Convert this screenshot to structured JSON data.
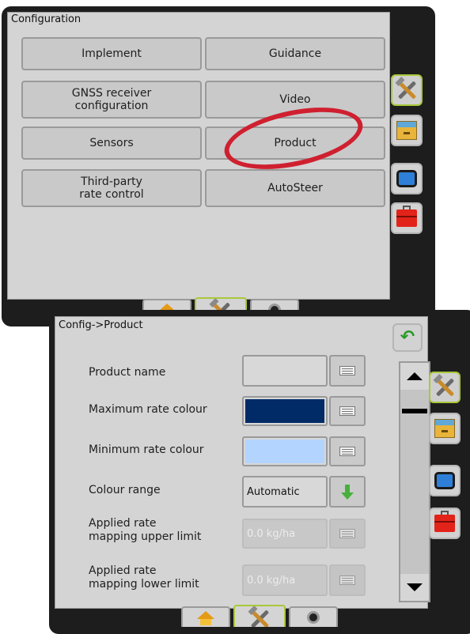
{
  "screen1": {
    "title": "Configuration",
    "buttons": [
      {
        "label": "Implement"
      },
      {
        "label": "Guidance"
      },
      {
        "label": "GNSS receiver\nconfiguration"
      },
      {
        "label": "Video"
      },
      {
        "label": "Sensors"
      },
      {
        "label": "Product"
      },
      {
        "label": "Third-party\nrate control"
      },
      {
        "label": "AutoSteer"
      }
    ],
    "side_tabs": [
      {
        "icon": "tools-icon",
        "active": true
      },
      {
        "icon": "drawer-icon",
        "active": false
      },
      {
        "icon": "screen-icon",
        "active": false
      },
      {
        "icon": "toolbox-icon",
        "active": false
      }
    ],
    "bottom_tabs": [
      {
        "icon": "home-icon",
        "active": false
      },
      {
        "icon": "tools-icon",
        "active": true
      },
      {
        "icon": "camera-icon",
        "active": false
      }
    ],
    "highlight": {
      "target": "Product",
      "color": "#cf2030"
    }
  },
  "screen2": {
    "breadcrumb": "Config->Product",
    "rows": [
      {
        "label": "Product name",
        "value": ""
      },
      {
        "label": "Maximum rate colour",
        "value": "",
        "swatch": "#002b66"
      },
      {
        "label": "Minimum rate colour",
        "value": "",
        "swatch": "#b3d4ff"
      },
      {
        "label": "Colour range",
        "value": "Automatic"
      },
      {
        "label": "Applied rate\nmapping upper limit",
        "value": "0.0 kg/ha",
        "disabled": true
      },
      {
        "label": "Applied rate\nmapping lower limit",
        "value": "0.0 kg/ha",
        "disabled": true
      }
    ],
    "colors": {
      "accent_active": "#a8c83a",
      "panel": "#d4d4d4",
      "frame": "#1d1d1d"
    }
  }
}
